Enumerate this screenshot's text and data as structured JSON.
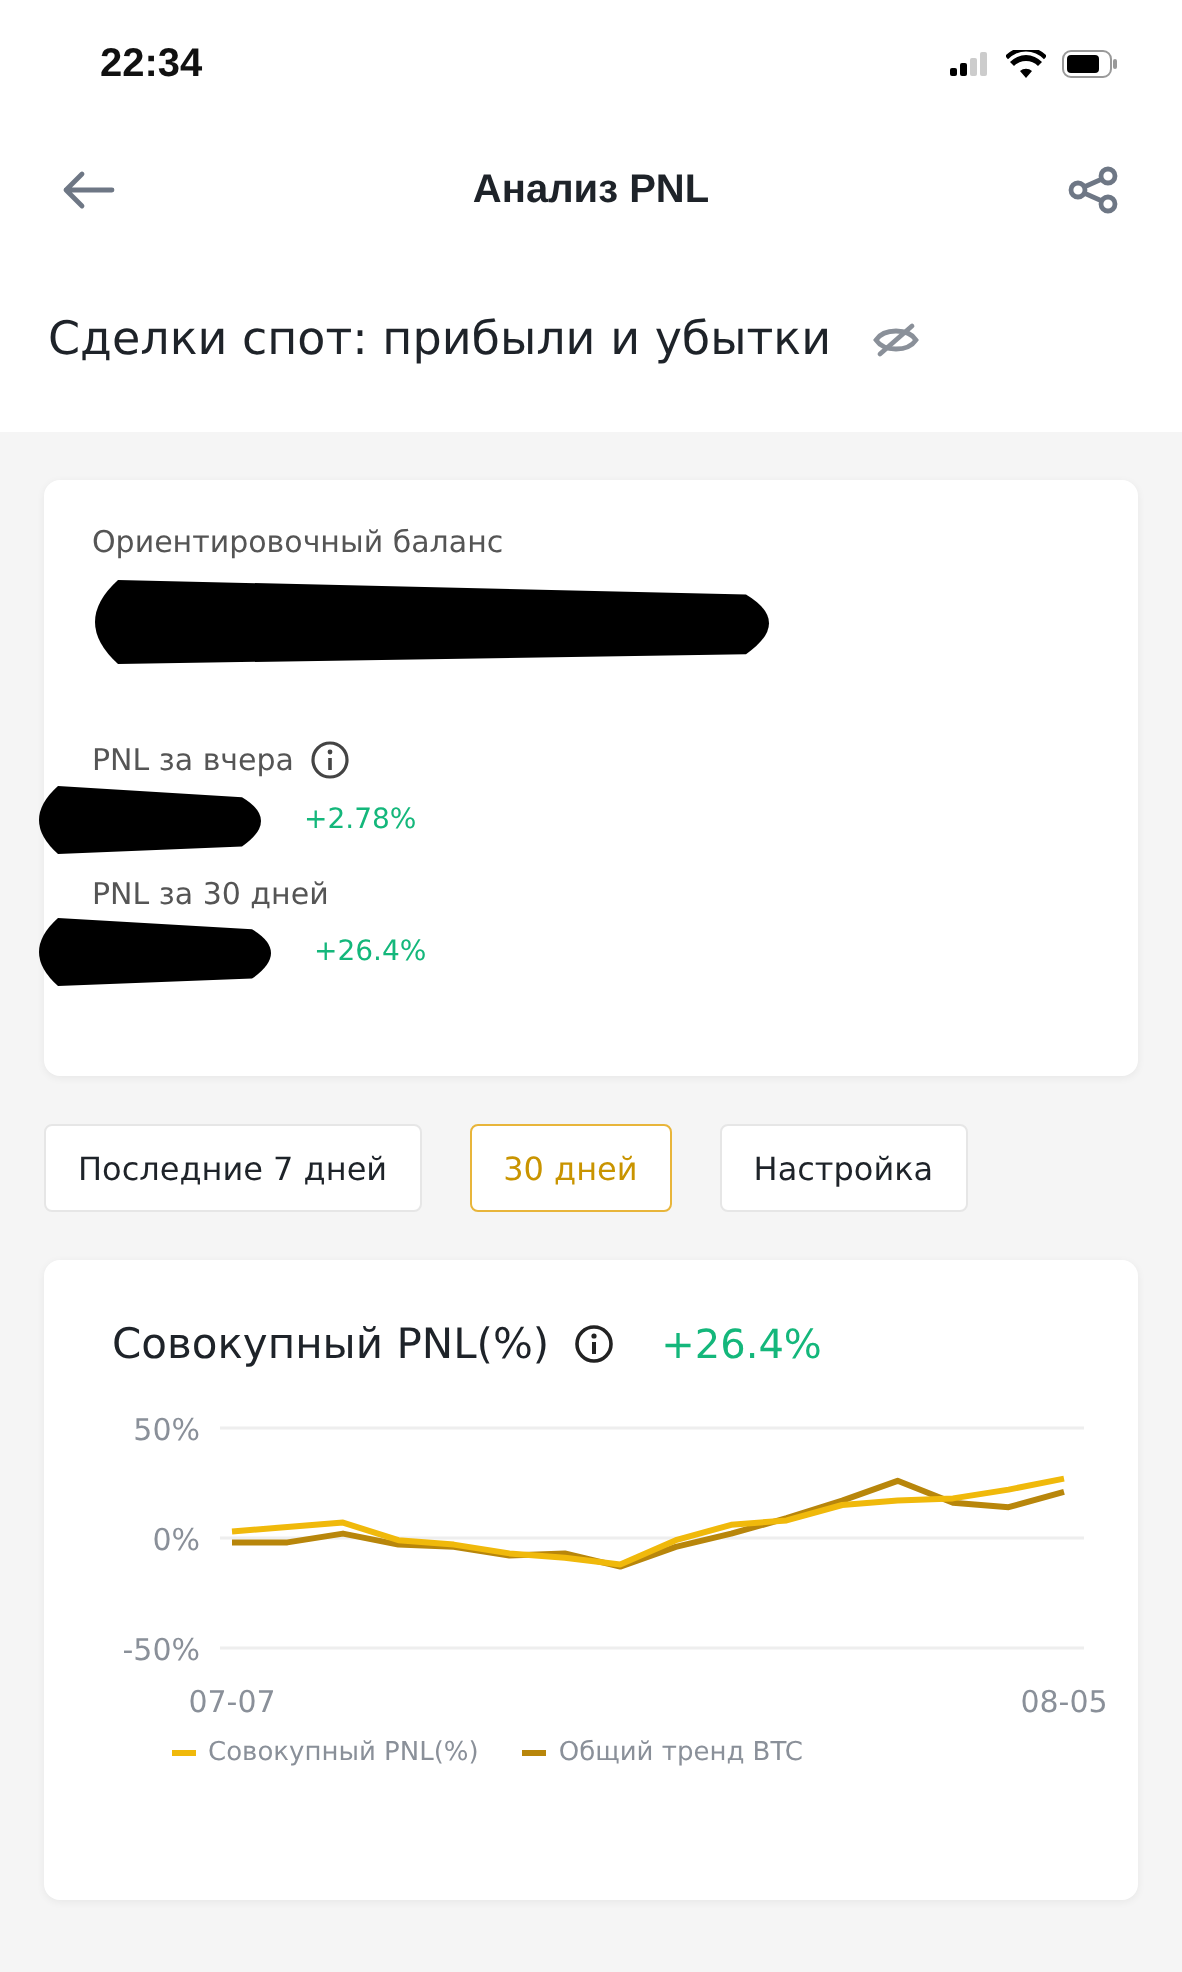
{
  "status_bar": {
    "time": "22:34"
  },
  "header": {
    "title": "Анализ PNL"
  },
  "section": {
    "title": "Сделки спот: прибыли и убытки"
  },
  "summary": {
    "items": [
      {
        "kind": "balance",
        "label": "Ориентировочный баланс",
        "redacted": true
      },
      {
        "kind": "change",
        "label": "PNL за вчера",
        "info": true,
        "redacted": true,
        "change": "+2.78%"
      },
      {
        "kind": "change",
        "label": "PNL за 30 дней",
        "info": false,
        "redacted": true,
        "change": "+26.4%"
      }
    ]
  },
  "periods": [
    {
      "label": "Последние 7 дней",
      "selected": false
    },
    {
      "label": "30 дней",
      "selected": true
    },
    {
      "label": "Настройка",
      "selected": false
    }
  ],
  "chart_card": {
    "title": "Совокупный PNL(%)",
    "change": "+26.4%",
    "chart_data": {
      "type": "line",
      "categories": [
        "07-07",
        null,
        null,
        null,
        null,
        null,
        null,
        null,
        null,
        null,
        null,
        null,
        null,
        null,
        null,
        "08-05"
      ],
      "ylim": [
        -50,
        50
      ],
      "yticks": [
        {
          "value": 50,
          "label": "50%"
        },
        {
          "value": 0,
          "label": "0%"
        },
        {
          "value": -50,
          "label": "-50%"
        }
      ],
      "series": [
        {
          "name": "Совокупный PNL(%)",
          "color": "#f0b90b",
          "values": [
            3,
            5,
            7,
            -1,
            -3,
            -7,
            -9,
            -12,
            -1,
            6,
            8,
            15,
            17,
            18,
            22,
            27
          ]
        },
        {
          "name": "Общий тренд BTC",
          "color": "#b8860b",
          "values": [
            -2,
            -2,
            2,
            -3,
            -4,
            -8,
            -7,
            -13,
            -4,
            2,
            9,
            17,
            26,
            16,
            14,
            21
          ]
        }
      ]
    }
  }
}
